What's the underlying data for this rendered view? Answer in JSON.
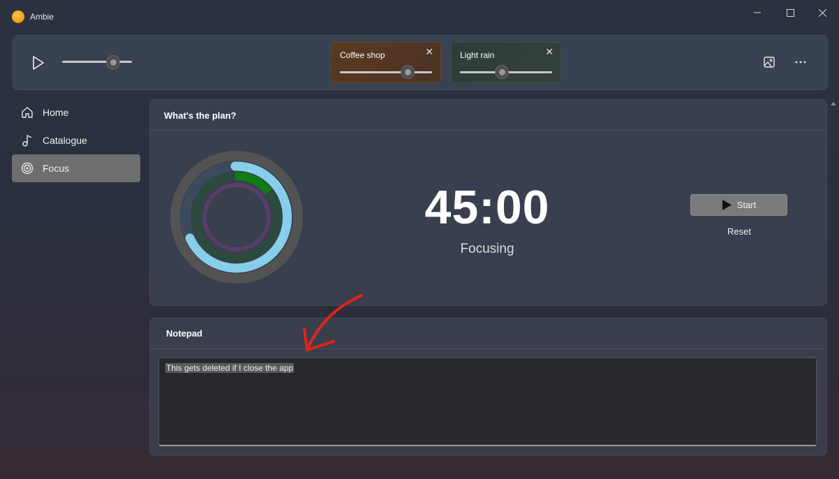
{
  "window": {
    "title": "Ambie",
    "controls": [
      "minimize",
      "maximize",
      "close"
    ]
  },
  "player": {
    "play_icon": "play-icon",
    "volume_level": 0.72,
    "sounds": [
      {
        "name": "Coffee shop",
        "volume_level": 0.73,
        "tint": "#5a3a22"
      },
      {
        "name": "Light rain",
        "volume_level": 0.45,
        "tint": "#2f3c37"
      }
    ],
    "actions": [
      "image-icon",
      "more-icon"
    ]
  },
  "nav": {
    "items": [
      {
        "label": "Home",
        "icon": "home-icon"
      },
      {
        "label": "Catalogue",
        "icon": "music-note-icon"
      },
      {
        "label": "Focus",
        "icon": "target-icon",
        "active": true
      }
    ]
  },
  "focus": {
    "title": "What's the plan?",
    "timer": "45:00",
    "status": "Focusing",
    "start_label": "Start",
    "reset_label": "Reset",
    "ring_colors": {
      "outer": "#545354",
      "focus": "#87ceeb",
      "green": "#0f7d14",
      "purple": "#5c3f6b"
    }
  },
  "notepad": {
    "title": "Notepad",
    "text": "This gets deleted if I close the app"
  }
}
